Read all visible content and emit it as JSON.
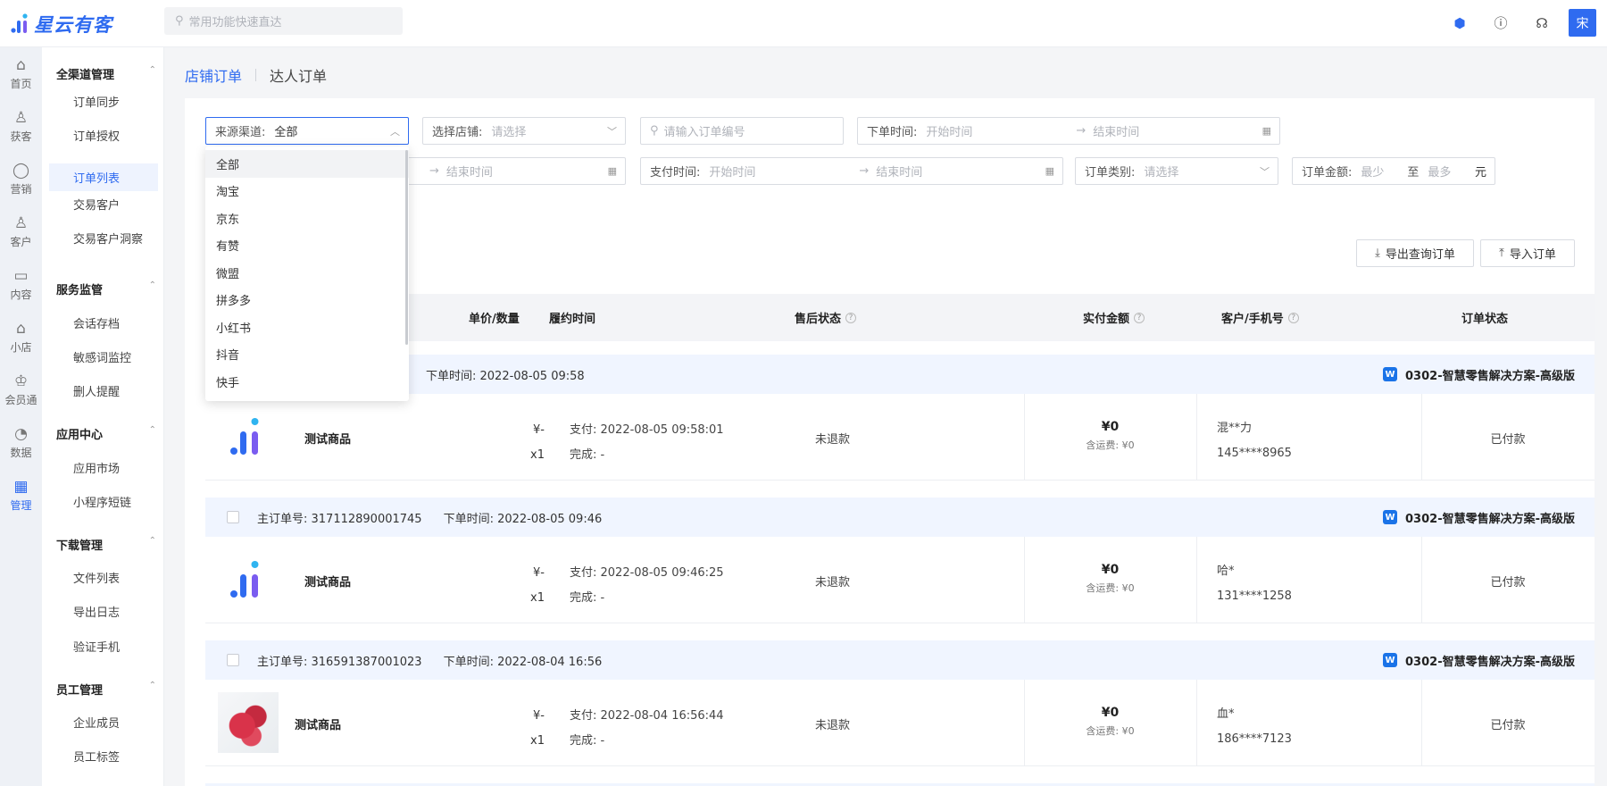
{
  "app": {
    "name": "星云有客"
  },
  "topbar": {
    "search_placeholder": "常用功能快速直达",
    "avatar_text": "宋"
  },
  "rail": [
    {
      "label": "首页",
      "icon": "home-icon",
      "glyph": "⌂"
    },
    {
      "label": "获客",
      "icon": "user-add-icon",
      "glyph": "♙"
    },
    {
      "label": "营销",
      "icon": "bulb-icon",
      "glyph": "◯"
    },
    {
      "label": "客户",
      "icon": "user-icon",
      "glyph": "♙"
    },
    {
      "label": "内容",
      "icon": "folder-icon",
      "glyph": "▭"
    },
    {
      "label": "小店",
      "icon": "shop-icon",
      "glyph": "⌂"
    },
    {
      "label": "会员通",
      "icon": "member-icon",
      "glyph": "♔"
    },
    {
      "label": "数据",
      "icon": "pie-chart-icon",
      "glyph": "◔"
    },
    {
      "label": "管理",
      "icon": "grid-icon",
      "glyph": "▦"
    }
  ],
  "menu": {
    "groups": [
      {
        "title": "全渠道管理",
        "items": [
          "订单同步",
          "订单授权",
          "订单列表",
          "交易客户",
          "交易客户洞察"
        ]
      },
      {
        "title": "服务监管",
        "items": [
          "会话存档",
          "敏感词监控",
          "删人提醒"
        ]
      },
      {
        "title": "应用中心",
        "items": [
          "应用市场",
          "小程序短链"
        ]
      },
      {
        "title": "下载管理",
        "items": [
          "文件列表",
          "导出日志",
          "验证手机"
        ]
      },
      {
        "title": "员工管理",
        "items": [
          "企业成员",
          "员工标签"
        ]
      }
    ],
    "active_item": "订单列表"
  },
  "tabs": {
    "store_orders": "店铺订单",
    "influencer_orders": "达人订单"
  },
  "filters": {
    "source_label": "来源渠道:",
    "source_value": "全部",
    "store_label": "选择店铺:",
    "store_placeholder": "请选择",
    "order_no_placeholder": "请输入订单编号",
    "order_time_label": "下单时间:",
    "start_time": "开始时间",
    "end_time": "结束时间",
    "pay_time_label": "支付时间:",
    "order_type_label": "订单类别:",
    "order_type_placeholder": "请选择",
    "amount_label": "订单金额:",
    "amount_min": "最少",
    "amount_to": "至",
    "amount_max": "最多",
    "amount_unit": "元"
  },
  "buttons": {
    "export": "导出查询订单",
    "import": "导入订单"
  },
  "table_headers": {
    "unit_qty": "单价/数量",
    "fulfill_time": "履约时间",
    "after_sale": "售后状态",
    "paid_amount": "实付金额",
    "customer_phone": "客户/手机号",
    "order_status": "订单状态"
  },
  "dropdown_options": [
    "全部",
    "淘宝",
    "京东",
    "有赞",
    "微盟",
    "拼多多",
    "小红书",
    "抖音",
    "快手"
  ],
  "orders": [
    {
      "main_order_label": "",
      "main_order_no": "",
      "order_time": "下单时间: 2022-08-05 09:58",
      "shop": "0302-智慧零售解决方案-高级版",
      "product": "测试商品",
      "price": "¥-",
      "qty": "x1",
      "pay_time": "支付: 2022-08-05 09:58:01",
      "done_time": "完成: -",
      "after_sale": "未退款",
      "amount": "¥0",
      "shipping": "含运费: ¥0",
      "customer": "混**力",
      "phone": "145****8965",
      "status": "已付款"
    },
    {
      "main_order_label": "主订单号:",
      "main_order_no": "主订单号: 317112890001745",
      "order_time": "下单时间: 2022-08-05 09:46",
      "shop": "0302-智慧零售解决方案-高级版",
      "product": "测试商品",
      "price": "¥-",
      "qty": "x1",
      "pay_time": "支付: 2022-08-05 09:46:25",
      "done_time": "完成: -",
      "after_sale": "未退款",
      "amount": "¥0",
      "shipping": "含运费: ¥0",
      "customer": "哈*",
      "phone": "131****1258",
      "status": "已付款"
    },
    {
      "main_order_label": "主订单号:",
      "main_order_no": "主订单号: 316591387001023",
      "order_time": "下单时间: 2022-08-04 16:56",
      "shop": "0302-智慧零售解决方案-高级版",
      "product": "测试商品",
      "price": "¥-",
      "qty": "x1",
      "pay_time": "支付: 2022-08-04 16:56:44",
      "done_time": "完成: -",
      "after_sale": "未退款",
      "amount": "¥0",
      "shipping": "含运费: ¥0",
      "customer": "血*",
      "phone": "186****7123",
      "status": "已付款"
    }
  ],
  "colors": {
    "accent": "#2f6bf0",
    "shop_badge": "#1a73e8"
  }
}
